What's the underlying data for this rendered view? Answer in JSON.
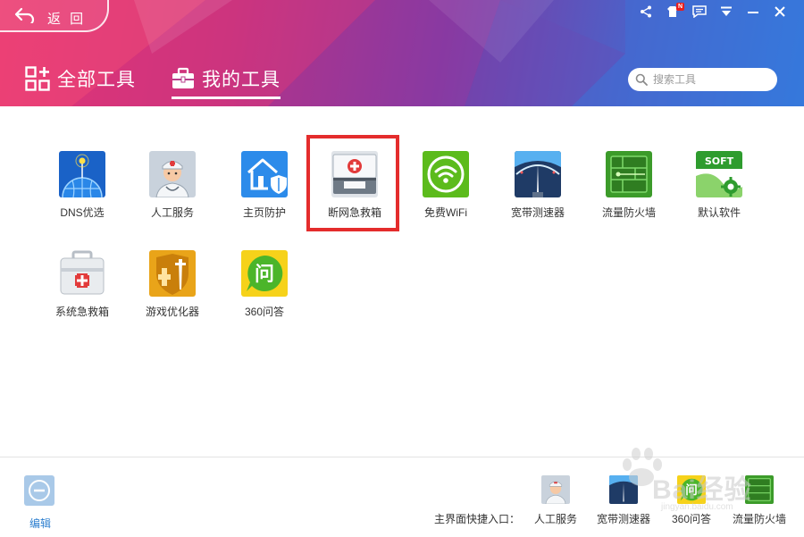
{
  "header": {
    "back_label": "返 回",
    "tabs": [
      {
        "label": "全部工具",
        "active": false
      },
      {
        "label": "我的工具",
        "active": true
      }
    ],
    "search_placeholder": "搜索工具",
    "top_icons": [
      "share-icon",
      "skin-icon",
      "message-icon",
      "menu-icon",
      "minimize-icon",
      "close-icon"
    ],
    "skin_badge": "N"
  },
  "tools": [
    {
      "label": "DNS优选",
      "icon": "dns-globe-icon"
    },
    {
      "label": "人工服务",
      "icon": "doctor-icon"
    },
    {
      "label": "主页防护",
      "icon": "home-shield-icon"
    },
    {
      "label": "断网急救箱",
      "icon": "network-firstaid-icon",
      "highlighted": true
    },
    {
      "label": "免费WiFi",
      "icon": "wifi-icon"
    },
    {
      "label": "宽带测速器",
      "icon": "speedometer-icon"
    },
    {
      "label": "流量防火墙",
      "icon": "firewall-icon"
    },
    {
      "label": "默认软件",
      "icon": "soft-gear-icon"
    },
    {
      "label": "系统急救箱",
      "icon": "system-firstaid-icon"
    },
    {
      "label": "游戏优化器",
      "icon": "game-shield-icon"
    },
    {
      "label": "360问答",
      "icon": "qa-icon"
    }
  ],
  "footer": {
    "edit_label": "编辑",
    "shortcut_title": "主界面快捷入口：",
    "shortcuts": [
      {
        "label": "人工服务",
        "icon": "doctor-icon"
      },
      {
        "label": "宽带测速器",
        "icon": "speedometer-icon"
      },
      {
        "label": "360问答",
        "icon": "qa-icon"
      },
      {
        "label": "流量防火墙",
        "icon": "firewall-icon"
      }
    ]
  },
  "watermark": {
    "text": "Bai经验",
    "sub": "jingyan.baidu.com"
  },
  "colors": {
    "accent_blue": "#2d7fcf",
    "highlight_red": "#e42c2c",
    "wifi_green": "#5cbb1c"
  }
}
